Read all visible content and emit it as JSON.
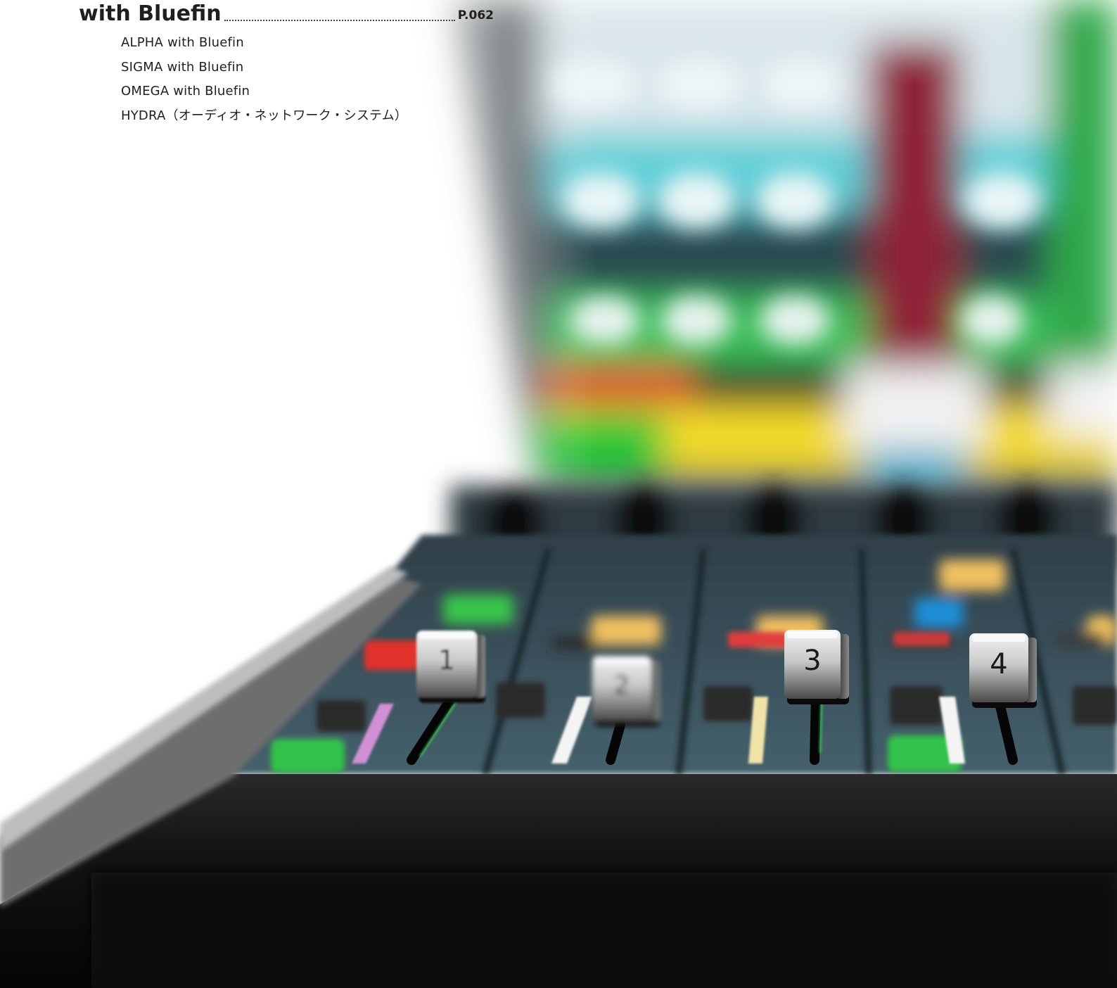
{
  "toc": {
    "section_title": "with Bluefin",
    "page_ref": "P.062",
    "items": [
      "ALPHA with Bluefin",
      "SIGMA with Bluefin",
      "OMEGA with Bluefin",
      "HYDRA（オーディオ・ネットワーク・システム）"
    ]
  },
  "photo": {
    "fader_labels": [
      "1",
      "2",
      "3",
      "4"
    ],
    "colors": {
      "console_dark": "#151515",
      "panel_blue": "#3a5563",
      "led_green": "#35c84a",
      "led_red": "#e0302c",
      "led_yellow": "#f4d63a",
      "led_amber": "#f0c060",
      "led_blue": "#1c8fd8",
      "screen_cyan": "#6fd3dc",
      "screen_maroon": "#8e2238"
    }
  }
}
